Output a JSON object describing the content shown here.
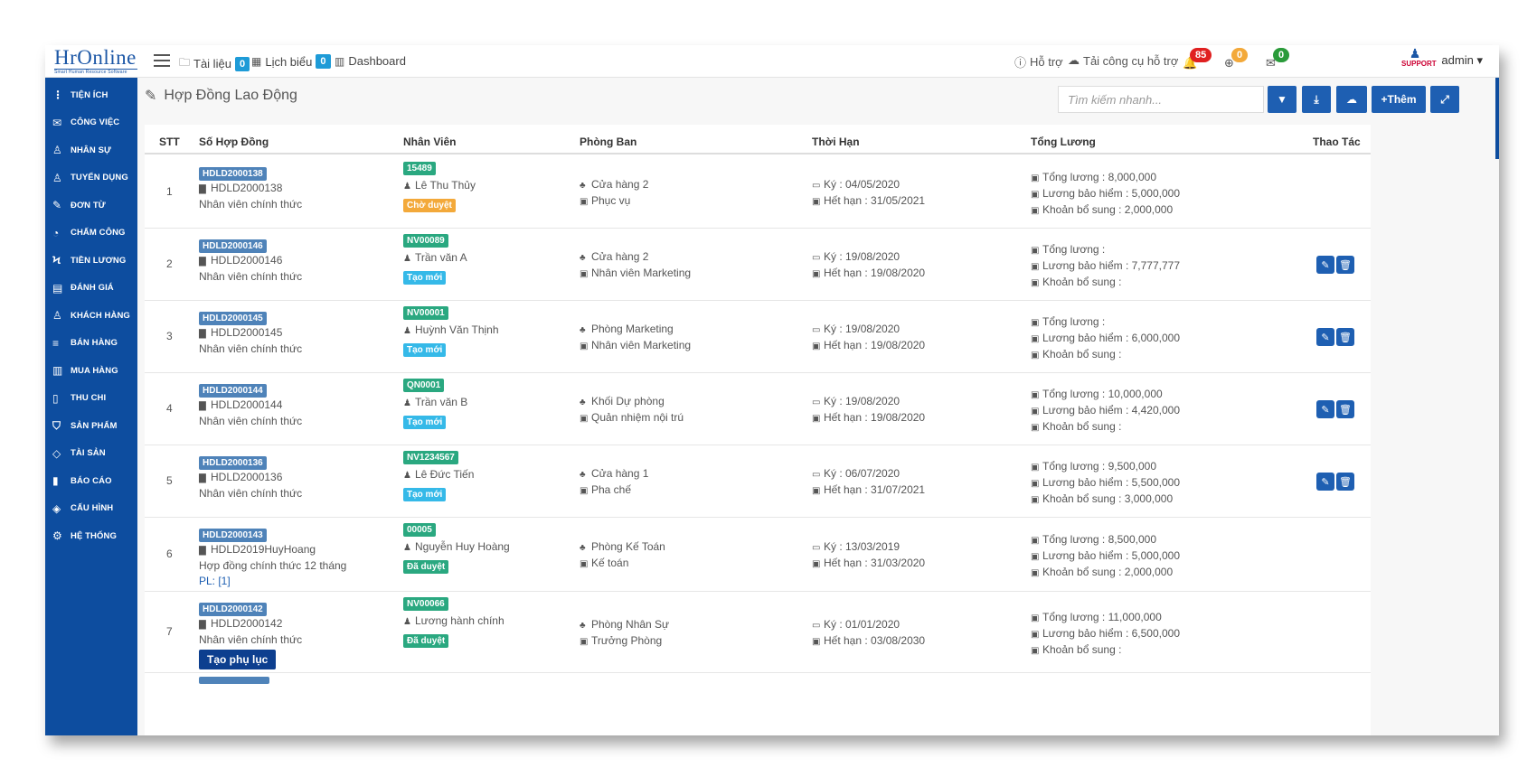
{
  "app": {
    "logo": "HrOnline",
    "logo_tag": "Smart Human Resource Software"
  },
  "topnav": [
    {
      "icon": "folder-icon",
      "label": "Tài liệu",
      "count": "0"
    },
    {
      "icon": "calendar-icon",
      "label": "Lịch biểu",
      "count": "0"
    },
    {
      "icon": "chart-bar-icon",
      "label": "Dashboard"
    }
  ],
  "topright": {
    "help": "Hỗ trợ",
    "download": "Tải công cụ hỗ trợ",
    "bell_count": "85",
    "globe_count": "0",
    "mail_count": "0",
    "user": "admin",
    "support_logo": "SUPPORT"
  },
  "sidebar": [
    {
      "icon": "⋮",
      "label": "Tiện ích"
    },
    {
      "icon": "✉",
      "label": "Công việc"
    },
    {
      "icon": "♙",
      "label": "Nhân sự"
    },
    {
      "icon": "♙",
      "label": "Tuyển dụng"
    },
    {
      "icon": "✎",
      "label": "Đơn từ"
    },
    {
      "icon": "◔",
      "label": "Chấm công"
    },
    {
      "icon": "ϟ",
      "label": "Tiền lương"
    },
    {
      "icon": "▤",
      "label": "Đánh giá"
    },
    {
      "icon": "♙",
      "label": "Khách hàng"
    },
    {
      "icon": "≡",
      "label": "Bán hàng"
    },
    {
      "icon": "▥",
      "label": "Mua hàng"
    },
    {
      "icon": "▯",
      "label": "Thu chi"
    },
    {
      "icon": "⛉",
      "label": "Sản phẩm"
    },
    {
      "icon": "◇",
      "label": "Tài sản"
    },
    {
      "icon": "▮",
      "label": "Báo cáo"
    },
    {
      "icon": "◈",
      "label": "Cấu hình"
    },
    {
      "icon": "⚙",
      "label": "Hệ thống"
    }
  ],
  "page": {
    "title": "Hợp Đồng Lao Động",
    "search_placeholder": "Tìm kiếm nhanh...",
    "add_label": "Thêm"
  },
  "table": {
    "headers": [
      "STT",
      "Số Hợp Đồng",
      "Nhân Viên",
      "Phòng Ban",
      "Thời Hạn",
      "Tổng Lương",
      "Thao Tác"
    ],
    "rows": [
      {
        "stt": "1",
        "code": "HDLD2000138",
        "doc": "HDLD2000138",
        "type": "Nhân viên chính thức",
        "emp_id": "15489",
        "emp": "Lê Thu Thủy",
        "status": "Chờ duyệt",
        "status_kind": "pend",
        "dept": "Cửa hàng 2",
        "pos": "Phục vụ",
        "sign": "Ký : 04/05/2020",
        "exp": "Hết hạn : 31/05/2021",
        "total": "Tổng lương : 8,000,000",
        "ins": "Lương bảo hiểm : 5,000,000",
        "extra": "Khoản bổ sung : 2,000,000",
        "actions": false
      },
      {
        "stt": "2",
        "code": "HDLD2000146",
        "doc": "HDLD2000146",
        "type": "Nhân viên chính thức",
        "emp_id": "NV00089",
        "emp": "Trần văn A",
        "status": "Tạo mới",
        "status_kind": "new",
        "dept": "Cửa hàng 2",
        "pos": "Nhân viên Marketing",
        "sign": "Ký : 19/08/2020",
        "exp": "Hết hạn : 19/08/2020",
        "total": "Tổng lương :",
        "ins": "Lương bảo hiểm : 7,777,777",
        "extra": "Khoản bổ sung :",
        "actions": true
      },
      {
        "stt": "3",
        "code": "HDLD2000145",
        "doc": "HDLD2000145",
        "type": "Nhân viên chính thức",
        "emp_id": "NV00001",
        "emp": "Huỳnh Văn Thịnh",
        "status": "Tạo mới",
        "status_kind": "new",
        "dept": "Phòng Marketing",
        "pos": "Nhân viên Marketing",
        "sign": "Ký : 19/08/2020",
        "exp": "Hết hạn : 19/08/2020",
        "total": "Tổng lương :",
        "ins": "Lương bảo hiểm : 6,000,000",
        "extra": "Khoản bổ sung :",
        "actions": true
      },
      {
        "stt": "4",
        "code": "HDLD2000144",
        "doc": "HDLD2000144",
        "type": "Nhân viên chính thức",
        "emp_id": "QN0001",
        "emp": "Trần văn B",
        "status": "Tạo mới",
        "status_kind": "new",
        "dept": "Khối Dự phòng",
        "pos": "Quản nhiệm nội trú",
        "sign": "Ký : 19/08/2020",
        "exp": "Hết hạn : 19/08/2020",
        "total": "Tổng lương : 10,000,000",
        "ins": "Lương bảo hiểm : 4,420,000",
        "extra": "Khoản bổ sung :",
        "actions": true
      },
      {
        "stt": "5",
        "code": "HDLD2000136",
        "doc": "HDLD2000136",
        "type": "Nhân viên chính thức",
        "emp_id": "NV1234567",
        "emp": "Lê Đức Tiến",
        "status": "Tạo mới",
        "status_kind": "new",
        "dept": "Cửa hàng 1",
        "pos": "Pha chế",
        "sign": "Ký : 06/07/2020",
        "exp": "Hết hạn : 31/07/2021",
        "total": "Tổng lương : 9,500,000",
        "ins": "Lương bảo hiểm : 5,500,000",
        "extra": "Khoản bổ sung : 3,000,000",
        "actions": true
      },
      {
        "stt": "6",
        "code": "HDLD2000143",
        "doc": "HDLD2019HuyHoang",
        "type": "Hợp đồng chính thức 12 tháng",
        "extra_line": "PL: [1]",
        "emp_id": "00005",
        "emp": "Nguyễn Huy Hoàng",
        "status": "Đã duyệt",
        "status_kind": "ok",
        "dept": "Phòng Kế Toán",
        "pos": "Kế toán",
        "sign": "Ký : 13/03/2019",
        "exp": "Hết hạn : 31/03/2020",
        "total": "Tổng lương : 8,500,000",
        "ins": "Lương bảo hiểm : 5,000,000",
        "extra": "Khoản bổ sung : 2,000,000",
        "actions": false
      },
      {
        "stt": "7",
        "code": "HDLD2000142",
        "doc": "HDLD2000142",
        "type": "Nhân viên chính thức",
        "button": "Tạo phụ lục",
        "emp_id": "NV00066",
        "emp": "Lương hành chính",
        "status": "Đã duyệt",
        "status_kind": "ok",
        "dept": "Phòng Nhân Sự",
        "pos": "Trưởng Phòng",
        "sign": "Ký : 01/01/2020",
        "exp": "Hết hạn : 03/08/2030",
        "total": "Tổng lương : 11,000,000",
        "ins": "Lương bảo hiểm : 6,500,000",
        "extra": "Khoản bổ sung :",
        "actions": false
      }
    ]
  }
}
